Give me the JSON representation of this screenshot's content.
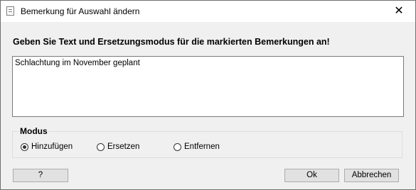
{
  "window": {
    "title": "Bemerkung für Auswahl ändern",
    "close_glyph": "✕"
  },
  "heading": "Geben Sie Text und Ersetzungsmodus für die markierten Bemerkungen an!",
  "text_value": "Schlachtung im November geplant",
  "mode": {
    "label": "Modus",
    "options": [
      "Hinzufügen",
      "Ersetzen",
      "Entfernen"
    ],
    "selected": "Hinzufügen"
  },
  "buttons": {
    "help": "?",
    "ok": "Ok",
    "cancel": "Abbrechen"
  },
  "icons": {
    "app": "document-icon",
    "close": "close-icon"
  }
}
